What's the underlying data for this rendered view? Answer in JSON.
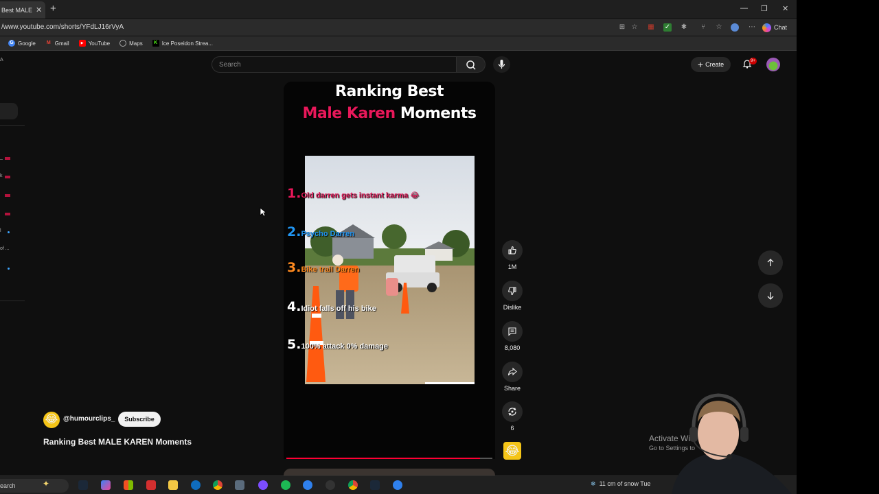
{
  "browser": {
    "tab_title": "Best MALE KA",
    "url": "/www.youtube.com/shorts/YFdLJ16rVyA",
    "chat_label": "Chat",
    "bookmarks": [
      {
        "label": "Google",
        "color": "#4285f4",
        "icon": "G"
      },
      {
        "label": "Gmail",
        "color": "#ea4335",
        "icon": "M"
      },
      {
        "label": "YouTube",
        "color": "#ff0000",
        "icon": "▶"
      },
      {
        "label": "Maps",
        "color": "#888888",
        "icon": "⊕"
      },
      {
        "label": "Ice Poseidon Strea...",
        "color": "#53fc18",
        "icon": "K"
      }
    ]
  },
  "youtube": {
    "search_placeholder": "Search",
    "create_label": "Create",
    "notification_badge": "9+"
  },
  "sidebar": {
    "fragments": [
      "A",
      "_",
      "k",
      "",
      "",
      "l",
      "of ...",
      ""
    ]
  },
  "short": {
    "overlay_title_line1": "Ranking Best",
    "overlay_title_line2_a": "Male Karen",
    "overlay_title_line2_b": "Moments",
    "rankings": [
      {
        "num": "1.",
        "text": "Old darren gets instant karma 😂",
        "color": "#e8185a"
      },
      {
        "num": "2.",
        "text": "Psycho Darren",
        "color": "#2196f3"
      },
      {
        "num": "3.",
        "text": "Bike trail Darren",
        "color": "#ff8a1f"
      },
      {
        "num": "4.",
        "text": "Idiot falls off his bike",
        "color": "#ffffff"
      },
      {
        "num": "5.",
        "text": "100% attack 0% damage",
        "color": "#ffffff"
      }
    ],
    "progress": 0.94,
    "channel_handle": "@humourclips_",
    "subscribe_label": "Subscribe",
    "title": "Ranking Best MALE KAREN Moments"
  },
  "actions": {
    "like_count": "1M",
    "dislike_label": "Dislike",
    "comment_count": "8,080",
    "share_label": "Share",
    "remix_count": "6"
  },
  "windows": {
    "activate_title": "Activate Win",
    "activate_sub": "Go to Settings to",
    "taskbar_search": "earch",
    "weather": "11 cm of snow Tue"
  }
}
